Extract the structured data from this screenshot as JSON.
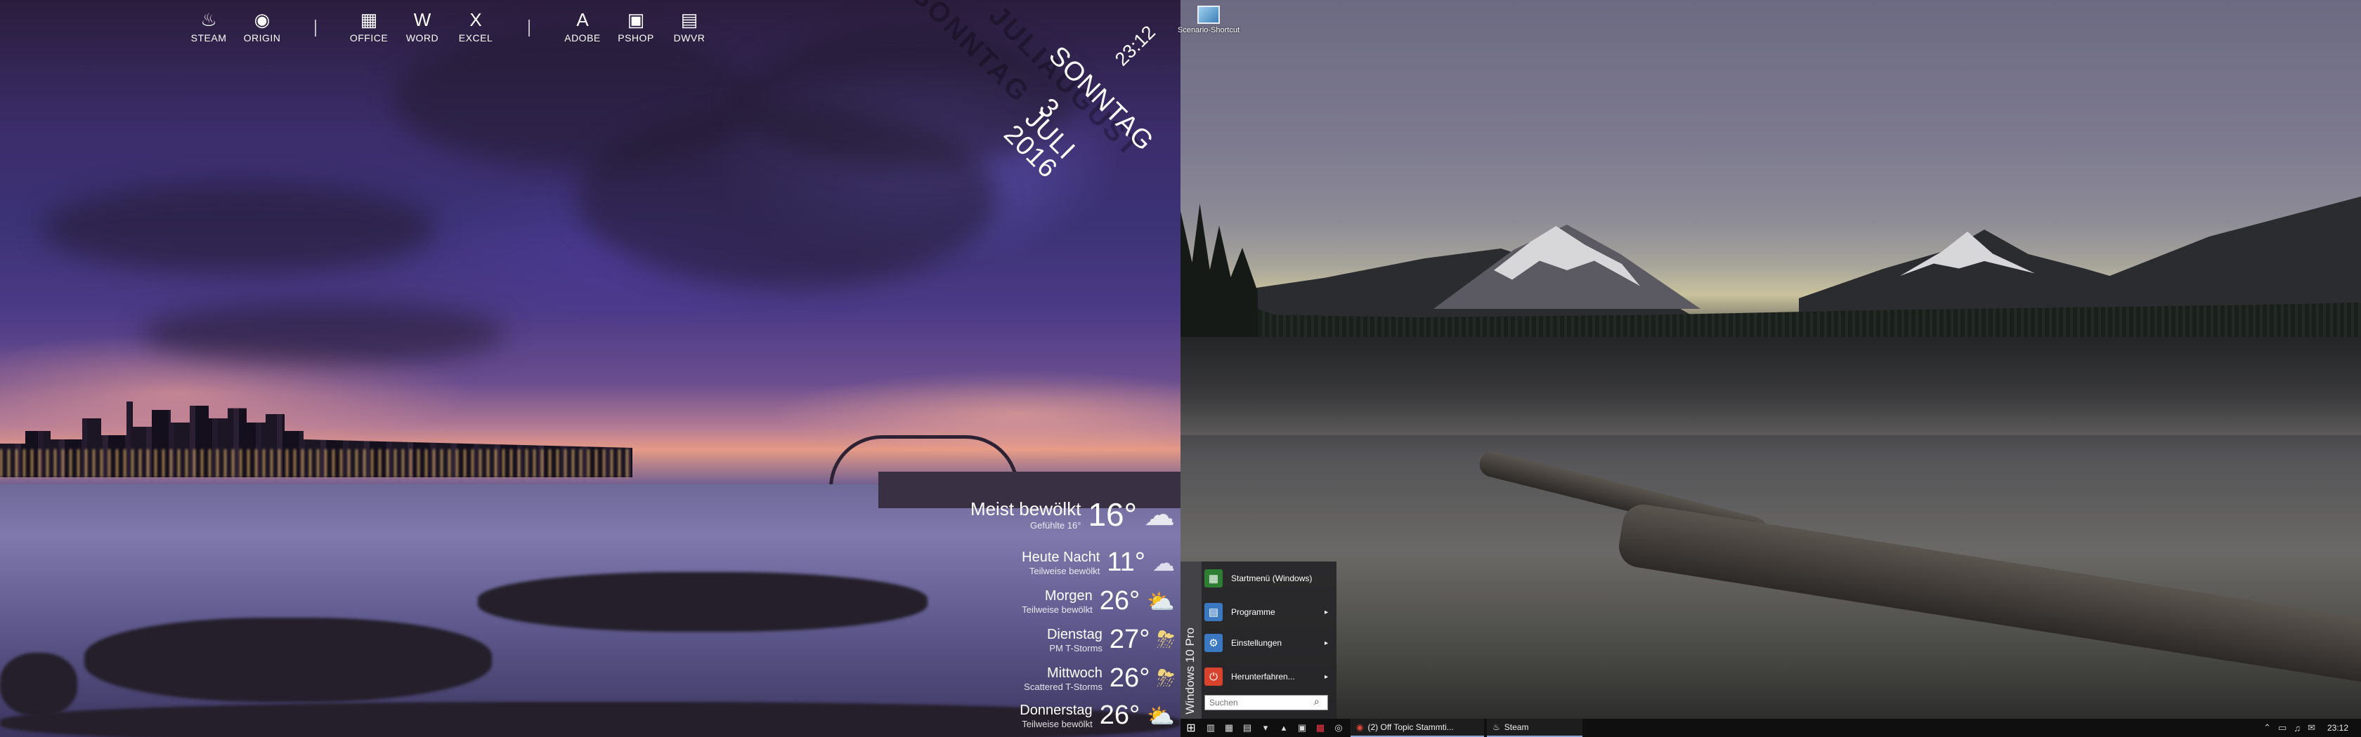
{
  "launcher": {
    "items": [
      {
        "label": "STEAM",
        "icon": "steam-icon",
        "glyph": "♨"
      },
      {
        "label": "ORIGIN",
        "icon": "origin-icon",
        "glyph": "◉"
      },
      {
        "label": "OFFICE",
        "icon": "office-icon",
        "glyph": "▦"
      },
      {
        "label": "WORD",
        "icon": "word-icon",
        "glyph": "W"
      },
      {
        "label": "EXCEL",
        "icon": "excel-icon",
        "glyph": "X"
      },
      {
        "label": "ADOBE",
        "icon": "adobe-icon",
        "glyph": "A"
      },
      {
        "label": "PSHOP",
        "icon": "photoshop-icon",
        "glyph": "▣"
      },
      {
        "label": "DWVR",
        "icon": "dreamweaver-icon",
        "glyph": "▤"
      }
    ]
  },
  "datetime": {
    "time": "23:12",
    "weekday": "SONNTAG",
    "day": "3",
    "month": "JULI",
    "year": "2016",
    "ghost_weekday": "SONNTAG",
    "ghost_month": "JULIAUGUST"
  },
  "weather": {
    "current": {
      "condition": "Meist bewölkt",
      "feels": "Gefühlte 16°",
      "temp": "16°",
      "icon": "cloud-icon",
      "glyph": "☁"
    },
    "forecast": [
      {
        "day": "Heute Nacht",
        "condition": "Teilweise bewölkt",
        "temp": "11°",
        "icon": "partly-cloudy-night-icon",
        "glyph": "☁"
      },
      {
        "day": "Morgen",
        "condition": "Teilweise bewölkt",
        "temp": "26°",
        "icon": "partly-cloudy-icon",
        "glyph": "⛅"
      },
      {
        "day": "Dienstag",
        "condition": "PM T-Storms",
        "temp": "27°",
        "icon": "thunderstorm-icon",
        "glyph": "⛈"
      },
      {
        "day": "Mittwoch",
        "condition": "Scattered T-Storms",
        "temp": "26°",
        "icon": "thunderstorm-icon",
        "glyph": "⛈"
      },
      {
        "day": "Donnerstag",
        "condition": "Teilweise bewölkt",
        "temp": "26°",
        "icon": "partly-cloudy-icon",
        "glyph": "⛅"
      }
    ]
  },
  "desktop": {
    "icon_label": "Scenario-Shortcut"
  },
  "start_menu": {
    "edition": "Windows 10 Pro",
    "items": [
      {
        "label": "Startmenü (Windows)",
        "icon": "start-icon",
        "glyph": "▦",
        "color": "#2d7d32",
        "arrow": false
      },
      {
        "label": "Programme",
        "icon": "programs-icon",
        "glyph": "▤",
        "color": "#3a79c2",
        "arrow": true
      },
      {
        "label": "Einstellungen",
        "icon": "settings-icon",
        "glyph": "⚙",
        "color": "#3a79c2",
        "arrow": true
      },
      {
        "label": "Herunterfahren...",
        "icon": "power-icon",
        "glyph": "⏻",
        "color": "#d9422c",
        "arrow": true
      }
    ],
    "search_placeholder": "Suchen",
    "arrow_glyph": "▸"
  },
  "taskbar": {
    "start_glyph": "⊞",
    "quick_icons": [
      {
        "name": "task-view-icon",
        "glyph": "▥"
      },
      {
        "name": "calculator-icon",
        "glyph": "▦"
      },
      {
        "name": "notepad-icon",
        "glyph": "▤"
      },
      {
        "name": "down-arrow-icon",
        "glyph": "▾"
      },
      {
        "name": "up-arrow-icon",
        "glyph": "▴"
      },
      {
        "name": "app-icon",
        "glyph": "▣"
      },
      {
        "name": "red-app-icon",
        "glyph": "▩"
      },
      {
        "name": "browser-icon",
        "glyph": "◎"
      }
    ],
    "tasks": [
      {
        "label": "(2) Off Topic Stammti...",
        "icon": "chrome-icon",
        "glyph": "◉"
      },
      {
        "label": "Steam",
        "icon": "steam-icon",
        "glyph": "♨"
      }
    ],
    "tray": [
      {
        "name": "tray-up-icon",
        "glyph": "⌃"
      },
      {
        "name": "network-icon",
        "glyph": "▭"
      },
      {
        "name": "volume-icon",
        "glyph": "♫"
      },
      {
        "name": "notification-icon",
        "glyph": "✉"
      }
    ],
    "time": "23:12"
  }
}
